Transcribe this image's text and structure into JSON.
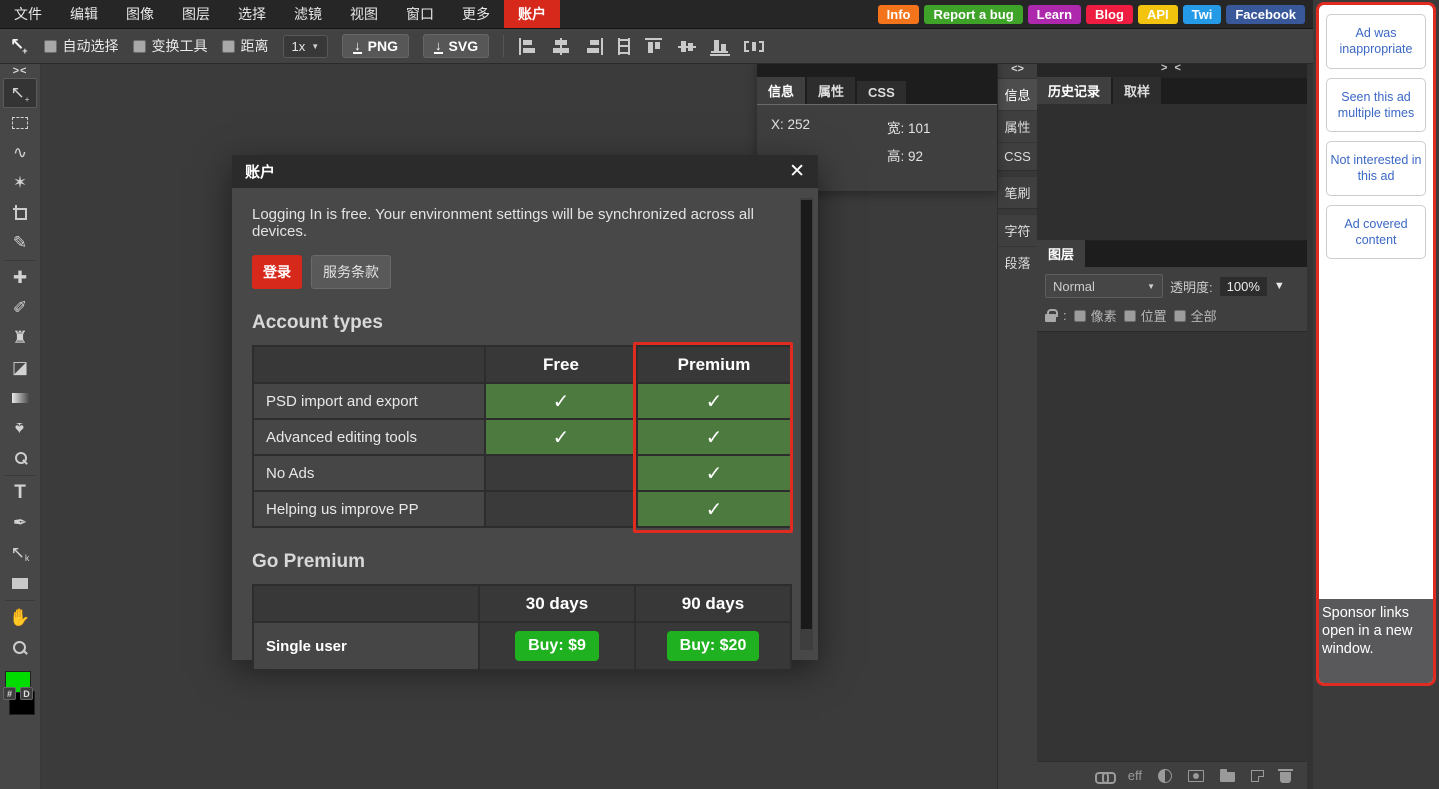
{
  "menubar": {
    "items": [
      "文件",
      "编辑",
      "图像",
      "图层",
      "选择",
      "滤镜",
      "视图",
      "窗口",
      "更多"
    ],
    "account": "账户",
    "links": [
      {
        "label": "Info",
        "color": "#f4741b"
      },
      {
        "label": "Report a bug",
        "color": "#3fa32a"
      },
      {
        "label": "Learn",
        "color": "#ae28ae"
      },
      {
        "label": "Blog",
        "color": "#ee1c41"
      },
      {
        "label": "API",
        "color": "#f2c40e"
      },
      {
        "label": "Twi",
        "color": "#259ae6"
      },
      {
        "label": "Facebook",
        "color": "#39589a"
      }
    ]
  },
  "toolbar": {
    "auto_select": "自动选择",
    "transform": "变换工具",
    "distance": "距离",
    "scale": "1x",
    "png": "PNG",
    "svg": "SVG"
  },
  "collapse": {
    "left": "><",
    "props": "<>",
    "right": "> <"
  },
  "tools": [
    "move",
    "marquee",
    "lasso",
    "magic-wand",
    "crop",
    "eyedropper",
    "heal",
    "brush",
    "clone-stamp",
    "eraser",
    "gradient",
    "blur",
    "dodge",
    "type",
    "pen",
    "path-select",
    "rectangle",
    "hand",
    "zoom"
  ],
  "swatches": {
    "foreground": "#00dc00",
    "background": "#000000",
    "hex_button": "#",
    "default_button": "D"
  },
  "info_panel": {
    "tabs": [
      "信息",
      "属性",
      "CSS"
    ],
    "readouts": {
      "x": "X: 252",
      "w": "宽: 101",
      "h": "高: 92"
    }
  },
  "side_tabs": [
    "信息",
    "属性",
    "CSS",
    "笔刷",
    "字符",
    "段落"
  ],
  "history_panel": {
    "tabs": [
      "历史记录",
      "取样"
    ]
  },
  "layers_panel": {
    "tab": "图层",
    "blend_mode": "Normal",
    "opacity_label": "透明度:",
    "opacity_value": "100%",
    "lock_sep": ":",
    "lock_pixels": "像素",
    "lock_position": "位置",
    "lock_all": "全部",
    "eff": "eff"
  },
  "dialog": {
    "title": "账户",
    "close": "✕",
    "intro": "Logging In is free. Your environment settings will be synchronized across all devices.",
    "login_label": "登录",
    "tos_label": "服务条款",
    "account_types": {
      "heading": "Account types",
      "columns": [
        "Free",
        "Premium"
      ],
      "rows": [
        {
          "label": "PSD import and export",
          "free": "✓",
          "premium": "✓"
        },
        {
          "label": "Advanced editing tools",
          "free": "✓",
          "premium": "✓"
        },
        {
          "label": "No Ads",
          "free": "",
          "premium": "✓"
        },
        {
          "label": "Helping us improve PP",
          "free": "",
          "premium": "✓"
        }
      ]
    },
    "go_premium": {
      "heading": "Go Premium",
      "columns": [
        "30 days",
        "90 days"
      ],
      "rows": [
        {
          "label": "Single user",
          "buy30": "Buy: $9",
          "buy90": "Buy: $20"
        }
      ]
    }
  },
  "ads": {
    "buttons": [
      "Ad was inappropriate",
      "Seen this ad multiple times",
      "Not interested in this ad",
      "Ad covered content"
    ],
    "footer": "Sponsor links open in a new window."
  },
  "colors": {
    "menubar_bg": "#262626",
    "account_red": "#d7281c",
    "toolbar_bg": "#424242",
    "canvas_bg": "#3b3b3b",
    "panel_bg": "#3f3f3f",
    "dialog_header": "#2b2b2b",
    "dialog_body": "#484848",
    "table_check_green": "#4c7a3f",
    "buy_green": "#1fb11f",
    "premium_outline_red": "#e02b20",
    "ad_border_red": "#e02b20",
    "ad_link_blue": "#3b68c5",
    "foreground_swatch": "#00dc00"
  }
}
